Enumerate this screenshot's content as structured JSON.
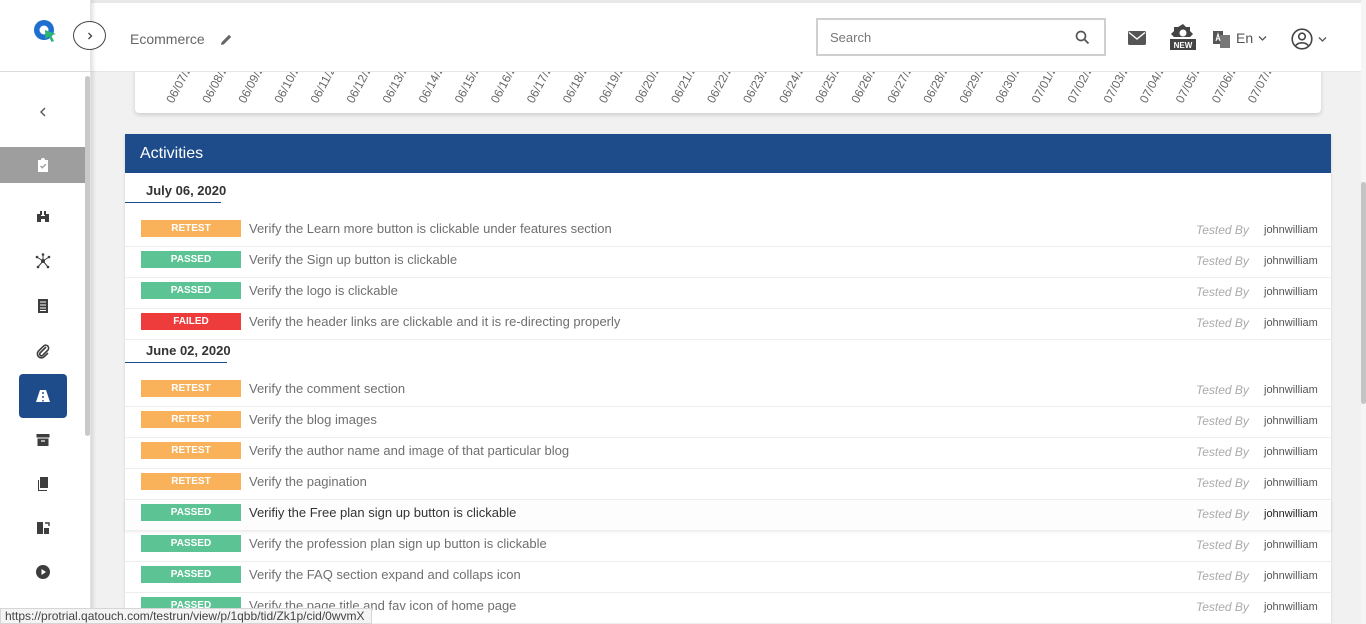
{
  "header": {
    "project_name": "Ecommerce",
    "search_placeholder": "Search",
    "language": "En"
  },
  "chart": {
    "x_tick_labels": [
      "06/07/2",
      "06/08/2",
      "06/09/2",
      "06/10/2",
      "06/11/2",
      "06/12/2",
      "06/13/2",
      "06/14/2",
      "06/15/2",
      "06/16/2",
      "06/17/2",
      "06/18/2",
      "06/19/2",
      "06/20/2",
      "06/21/2",
      "06/22/2",
      "06/23/2",
      "06/24/2",
      "06/25/2",
      "06/26/2",
      "06/27/2",
      "06/28/2",
      "06/29/2",
      "06/30/2",
      "07/01/2",
      "07/02/2",
      "07/03/2",
      "07/04/2",
      "07/05/2",
      "07/06/2",
      "07/07/2"
    ]
  },
  "activities": {
    "title": "Activities",
    "tested_by_label": "Tested By",
    "groups": [
      {
        "date": "July 06, 2020",
        "items": [
          {
            "status": "RETEST",
            "text": "Verify the Learn more button is clickable under features section",
            "tester": "johnwilliam"
          },
          {
            "status": "PASSED",
            "text": "Verify the Sign up button is clickable",
            "tester": "johnwilliam"
          },
          {
            "status": "PASSED",
            "text": "Verify the logo is clickable",
            "tester": "johnwilliam"
          },
          {
            "status": "FAILED",
            "text": "Verify the header links are clickable and it is re-directing properly",
            "tester": "johnwilliam"
          }
        ]
      },
      {
        "date": "June 02, 2020",
        "items": [
          {
            "status": "RETEST",
            "text": "Verify the comment section",
            "tester": "johnwilliam"
          },
          {
            "status": "RETEST",
            "text": "Verify the blog images",
            "tester": "johnwilliam"
          },
          {
            "status": "RETEST",
            "text": "Verify the author name and image of that particular blog",
            "tester": "johnwilliam"
          },
          {
            "status": "RETEST",
            "text": "Verify the pagination",
            "tester": "johnwilliam"
          },
          {
            "status": "PASSED",
            "text": "Verifiy the Free plan sign up button is clickable",
            "tester": "johnwilliam"
          },
          {
            "status": "PASSED",
            "text": "Verify the profession plan sign up button is clickable",
            "tester": "johnwilliam"
          },
          {
            "status": "PASSED",
            "text": "Verify the FAQ section expand and collaps icon",
            "tester": "johnwilliam"
          },
          {
            "status": "PASSED",
            "text": "Verify the page title and fav icon of home page",
            "tester": "johnwilliam"
          }
        ]
      }
    ]
  },
  "status_bar": {
    "url": "https://protrial.qatouch.com/testrun/view/p/1qbb/tid/Zk1p/cid/0wvmX"
  },
  "colors": {
    "primary": "#1e4c8a",
    "retest": "#f9b15a",
    "passed": "#5cc394",
    "failed": "#ee3b3b"
  }
}
